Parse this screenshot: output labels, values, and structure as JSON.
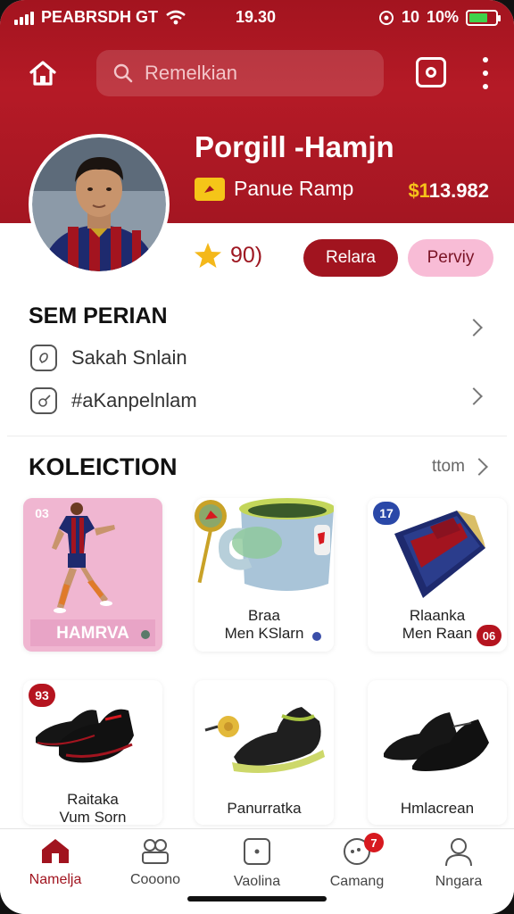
{
  "status_bar": {
    "carrier": "PEABRSDH GT",
    "time": "19.30",
    "right_text": "10",
    "battery": "10%",
    "battery_level": 0.7,
    "battery_color": "#3fd24a"
  },
  "header": {
    "search_placeholder": "Remelkian",
    "accent": "#a3141f"
  },
  "profile": {
    "name": "Porgill -Hamjn",
    "team": "Panue Ramp",
    "balance_currency": "$1",
    "balance_amount": "13.982",
    "rating": "90)",
    "primary_button": "Relara",
    "secondary_button": "Perviy"
  },
  "section_personal": {
    "title": "SEM PERIAN",
    "items": [
      {
        "label": "Sakah Snlain",
        "icon": "shield-icon"
      },
      {
        "label": "#aKanpelnlam",
        "icon": "edit-icon"
      }
    ]
  },
  "collection": {
    "title": "KOLEICTION",
    "see_all": "ttom",
    "items": [
      {
        "badge": "03",
        "badge_color": "#b5141f",
        "caption": "HAMRVA",
        "icon": "player-photo"
      },
      {
        "line1": "Braa",
        "line2": "Men KSlarn",
        "icon": "mug-icon"
      },
      {
        "badge": "17",
        "badge_color": "#2a48a8",
        "line1": "Rlaanka",
        "line2": "Men Raan",
        "corner": "06",
        "icon": "scarf-icon"
      },
      {
        "badge": "93",
        "badge_color": "#b5141f",
        "line1": "Raitaka",
        "line2": "Vum Sorn",
        "icon": "boots-icon"
      },
      {
        "line1": "Panurratka",
        "icon": "sneaker-icon"
      },
      {
        "line1": "Hmlacrean",
        "icon": "shoes-icon"
      }
    ]
  },
  "tabbar": {
    "tabs": [
      {
        "label": "Namelja",
        "icon": "home-icon",
        "active": true
      },
      {
        "label": "Cooono",
        "icon": "community-icon"
      },
      {
        "label": "Vaolina",
        "icon": "ticket-icon"
      },
      {
        "label": "Camang",
        "icon": "chat-icon",
        "badge": "7"
      },
      {
        "label": "Nngara",
        "icon": "profile-icon"
      }
    ]
  }
}
